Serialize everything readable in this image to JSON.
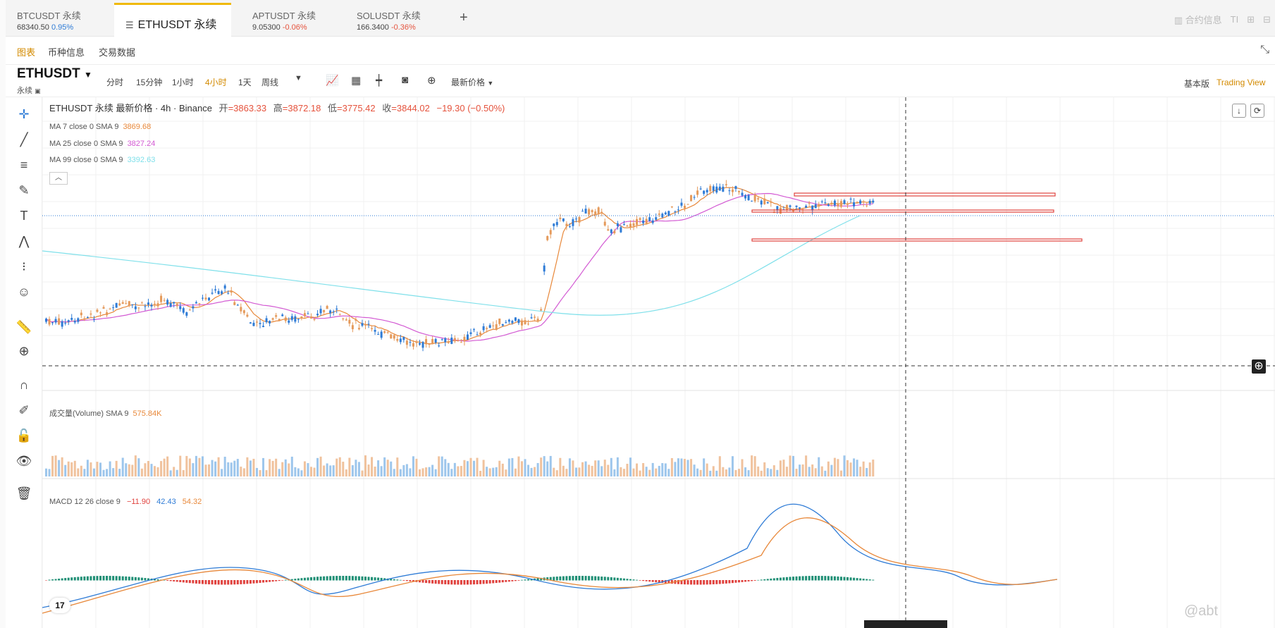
{
  "tabs": [
    {
      "name": "BTCUSDT 永续",
      "price": "68340.50",
      "change": "0.95%",
      "dir": "up"
    },
    {
      "name": "ETHUSDT 永续",
      "price": "",
      "change": "",
      "dir": "active"
    },
    {
      "name": "APTUSDT 永续",
      "price": "9.05300",
      "change": "-0.06%",
      "dir": "down"
    },
    {
      "name": "SOLUSDT 永续",
      "price": "166.3400",
      "change": "-0.36%",
      "dir": "down"
    }
  ],
  "top_right": {
    "contract_info": "合约信息",
    "ti": "TI",
    "grid": "⊞",
    "more": "⊟"
  },
  "sub_nav": {
    "chart": "图表",
    "coin_info": "币种信息",
    "trade_data": "交易数据"
  },
  "toolbar": {
    "symbol": "ETHUSDT",
    "symbol_sub": "永续",
    "timeframes": [
      "分时",
      "15分钟",
      "1小时",
      "4小时",
      "1天",
      "周线"
    ],
    "active_timeframe": "4小时",
    "price_type": "最新价格",
    "basic": "基本版",
    "tradingview": "Trading View"
  },
  "legend": {
    "title": "ETHUSDT 永续 最新价格 · 4h · Binance",
    "open_label": "开",
    "open": "=3863.33",
    "high_label": "高",
    "high": "=3872.18",
    "low_label": "低",
    "low": "=3775.42",
    "close_label": "收",
    "close": "=3844.02",
    "chg": "−19.30 (−0.50%)",
    "ma7_label": "MA 7 close 0 SMA 9",
    "ma7": "3869.68",
    "ma25_label": "MA 25 close 0 SMA 9",
    "ma25": "3827.24",
    "ma99_label": "MA 99 close 0 SMA 9",
    "ma99": "3392.63",
    "volume_label": "成交量(Volume) SMA 9",
    "volume": "575.84K",
    "macd_label": "MACD 12 26 close 9",
    "macd_hist": "−11.90",
    "macd_line": "42.43",
    "macd_signal": "54.32"
  },
  "watermark": "@abt",
  "colors": {
    "up": "#2e7bd6",
    "down": "#e59a5b",
    "ma7": "#e8883a",
    "ma25": "#d35ad3",
    "ma99": "#7fe0ea",
    "accent": "#d38a00",
    "hist_up": "#1f8f75",
    "hist_down": "#e0423e"
  }
}
